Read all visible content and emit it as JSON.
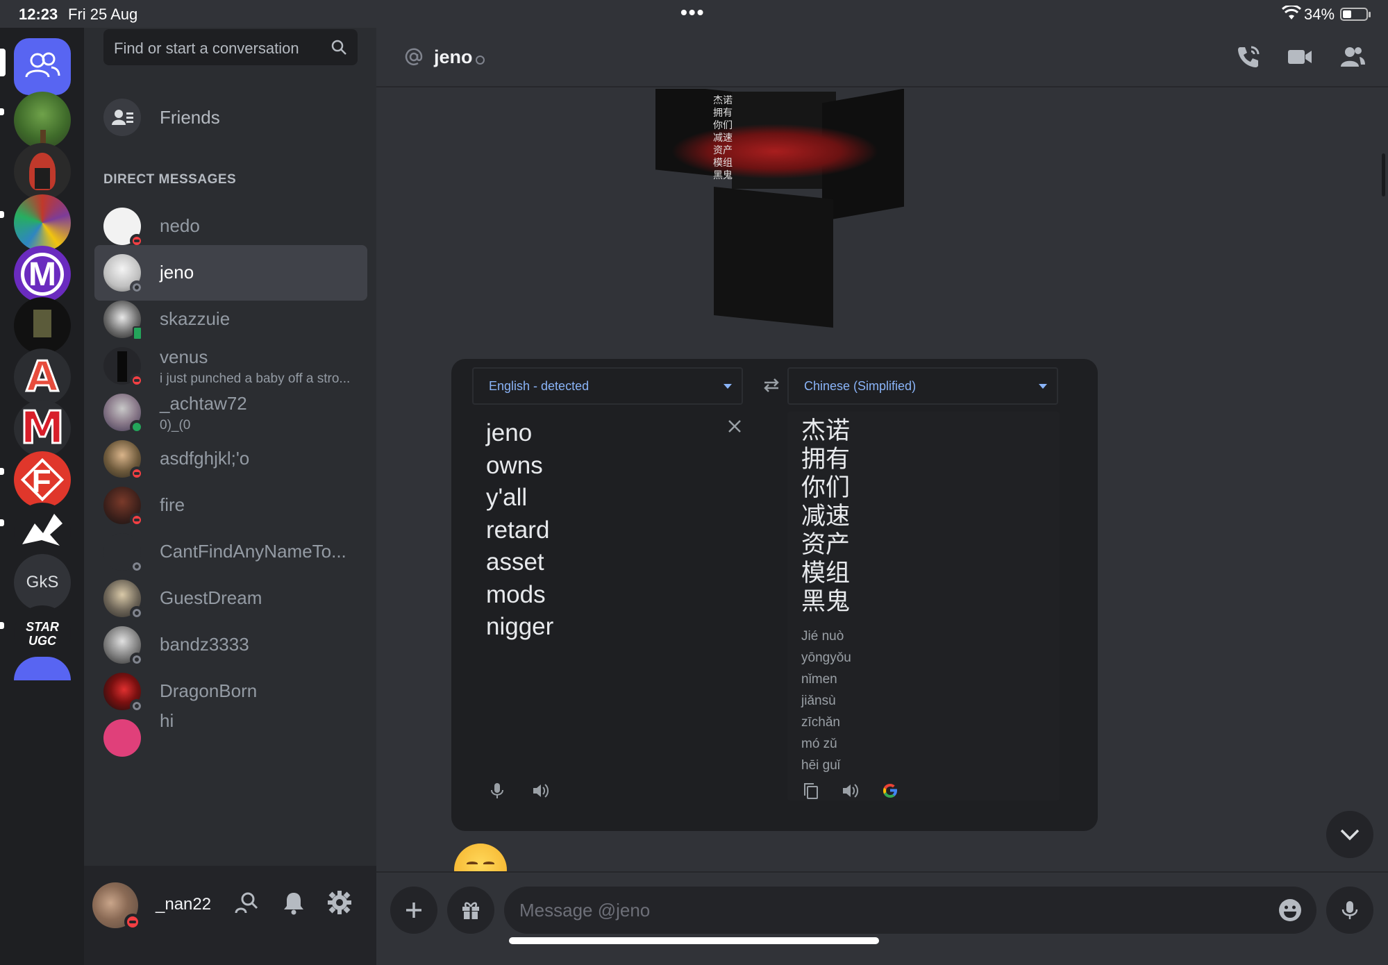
{
  "status_bar": {
    "time": "12:23",
    "date": "Fri 25 Aug",
    "battery": "34%"
  },
  "search": {
    "placeholder": "Find or start a conversation"
  },
  "friends_label": "Friends",
  "dm_header": "DIRECT MESSAGES",
  "dms": [
    {
      "name": "nedo",
      "sub": "",
      "status": "dnd"
    },
    {
      "name": "jeno",
      "sub": "",
      "status": "offline"
    },
    {
      "name": "skazzuie",
      "sub": "",
      "status": "mobile"
    },
    {
      "name": "venus",
      "sub": "i just punched a baby off a stro...",
      "status": "dnd"
    },
    {
      "name": "_achtaw72",
      "sub": "0)_(0",
      "status": "online"
    },
    {
      "name": "asdfghjkl;'o",
      "sub": "",
      "status": "dnd"
    },
    {
      "name": "fire",
      "sub": "",
      "status": "dnd"
    },
    {
      "name": "CantFindAnyNameTo...",
      "sub": "",
      "status": "offline"
    },
    {
      "name": "GuestDream",
      "sub": "",
      "status": "offline"
    },
    {
      "name": "bandz3333",
      "sub": "",
      "status": "offline"
    },
    {
      "name": "DragonBorn",
      "sub": "",
      "status": "offline"
    },
    {
      "name": "hi",
      "sub": "",
      "status": "none"
    }
  ],
  "servers": [
    {
      "icon": "tree-avatar"
    },
    {
      "icon": "spartan-helmet-avatar"
    },
    {
      "icon": "collage-avatar"
    },
    {
      "icon": "m-logo-purple"
    },
    {
      "icon": "character-avatar"
    },
    {
      "icon": "a-logo"
    },
    {
      "icon": "m-logo-red"
    },
    {
      "icon": "f-logo"
    },
    {
      "icon": "dragon-logo"
    },
    {
      "label": "GkS"
    },
    {
      "label": "STAR UGC"
    },
    {
      "icon": "partial-avatar"
    }
  ],
  "user": {
    "name": "_nan22"
  },
  "chat": {
    "recipient": "jeno",
    "message_placeholder": "Message @jeno"
  },
  "translator": {
    "source_lang": "English - detected",
    "target_lang": "Chinese (Simplified)",
    "source_lines": [
      "jeno",
      "owns",
      "y'all",
      "retard",
      "asset",
      "mods",
      "nigger"
    ],
    "target_lines": [
      "杰诺",
      "拥有",
      "你们",
      "减速",
      "资产",
      "模组",
      "黑鬼"
    ],
    "pinyin_lines": [
      "Jié nuò",
      "yōngyǒu",
      "nǐmen",
      "jiǎnsù",
      "zīchǎn",
      "mó zǔ",
      "hēi guǐ"
    ]
  },
  "image_overlay_chars": [
    "杰诺",
    "拥有",
    "你们",
    "减速",
    "资产",
    "模组",
    "黑鬼"
  ],
  "colors": {
    "blurple": "#5865f2",
    "dnd": "#f23f43",
    "online": "#23a55a",
    "link": "#8ab4f8"
  }
}
